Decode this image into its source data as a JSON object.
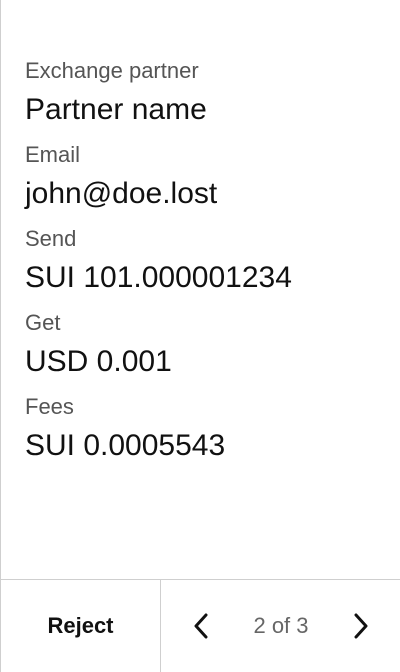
{
  "details": {
    "fields": [
      {
        "label": "Exchange partner",
        "value": "Partner name"
      },
      {
        "label": "Email",
        "value": "john@doe.lost"
      },
      {
        "label": "Send",
        "value": "SUI 101.000001234"
      },
      {
        "label": "Get",
        "value": "USD 0.001"
      },
      {
        "label": "Fees",
        "value": "SUI 0.0005543"
      }
    ]
  },
  "footer": {
    "reject_label": "Reject",
    "page_label": "2 of 3",
    "prev_icon": "chevron-left-icon",
    "next_icon": "chevron-right-icon"
  }
}
